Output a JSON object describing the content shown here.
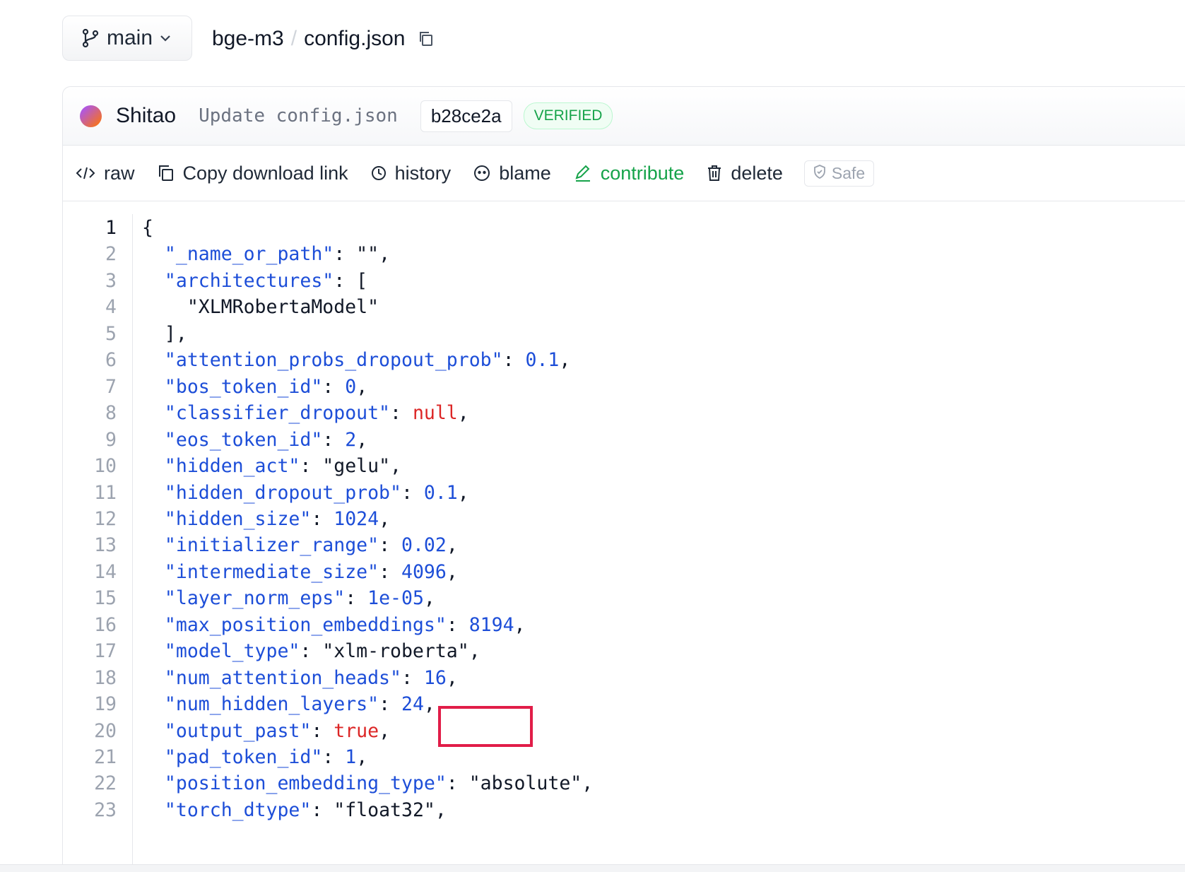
{
  "branch": {
    "name": "main"
  },
  "breadcrumb": {
    "repo": "bge-m3",
    "separator": "/",
    "file": "config.json"
  },
  "commit": {
    "author": "Shitao",
    "message": "Update config.json",
    "hash": "b28ce2a",
    "badge": "VERIFIED"
  },
  "toolbar": {
    "raw": "raw",
    "copy_link": "Copy download link",
    "history": "history",
    "blame": "blame",
    "contribute": "contribute",
    "delete": "delete",
    "safe": "Safe"
  },
  "code": {
    "lines": [
      "{",
      "  \"_name_or_path\": \"\",",
      "  \"architectures\": [",
      "    \"XLMRobertaModel\"",
      "  ],",
      "  \"attention_probs_dropout_prob\": 0.1,",
      "  \"bos_token_id\": 0,",
      "  \"classifier_dropout\": null,",
      "  \"eos_token_id\": 2,",
      "  \"hidden_act\": \"gelu\",",
      "  \"hidden_dropout_prob\": 0.1,",
      "  \"hidden_size\": 1024,",
      "  \"initializer_range\": 0.02,",
      "  \"intermediate_size\": 4096,",
      "  \"layer_norm_eps\": 1e-05,",
      "  \"max_position_embeddings\": 8194,",
      "  \"model_type\": \"xlm-roberta\",",
      "  \"num_attention_heads\": 16,",
      "  \"num_hidden_layers\": 24,",
      "  \"output_past\": true,",
      "  \"pad_token_id\": 1,",
      "  \"position_embedding_type\": \"absolute\",",
      "  \"torch_dtype\": \"float32\","
    ]
  },
  "colors": {
    "accent_green": "#16a34a",
    "key_blue": "#1d4ed8",
    "keyword_red": "#dc2626",
    "highlight": "#e11d48"
  }
}
